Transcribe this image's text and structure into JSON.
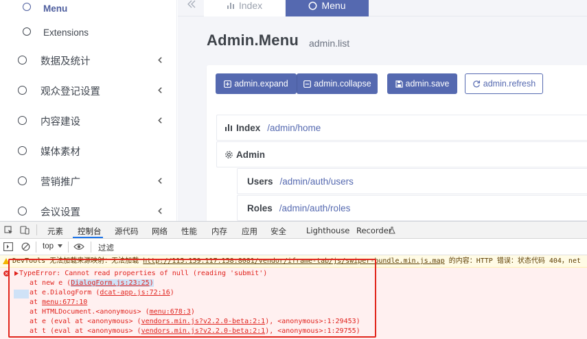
{
  "sidebar": {
    "items": [
      {
        "label": "Menu",
        "level": "sub",
        "active": true,
        "has_children": false
      },
      {
        "label": "Extensions",
        "level": "sub",
        "active": false,
        "has_children": false
      },
      {
        "label": "数据及统计",
        "level": "top",
        "active": false,
        "has_children": true
      },
      {
        "label": "观众登记设置",
        "level": "top",
        "active": false,
        "has_children": true
      },
      {
        "label": "内容建设",
        "level": "top",
        "active": false,
        "has_children": true
      },
      {
        "label": "媒体素材",
        "level": "top",
        "active": false,
        "has_children": false
      },
      {
        "label": "营销推广",
        "level": "top",
        "active": false,
        "has_children": true
      },
      {
        "label": "会议设置",
        "level": "top",
        "active": false,
        "has_children": true
      }
    ]
  },
  "tabs": {
    "index_label": "Index",
    "menu_label": "Menu"
  },
  "header": {
    "title": "Admin.Menu",
    "subtitle": "admin.list"
  },
  "toolbar": {
    "expand_label": "admin.expand",
    "collapse_label": "admin.collapse",
    "save_label": "admin.save",
    "refresh_label": "admin.refresh"
  },
  "tree": [
    {
      "name": "Index",
      "path": "/admin/home",
      "icon": "bar-chart-icon"
    },
    {
      "name": "Admin",
      "path": "",
      "icon": "gear-icon"
    },
    {
      "name": "Users",
      "path": "/admin/auth/users",
      "icon": ""
    },
    {
      "name": "Roles",
      "path": "/admin/auth/roles",
      "icon": ""
    }
  ],
  "devtools": {
    "tabs": [
      "元素",
      "控制台",
      "源代码",
      "网络",
      "性能",
      "内存",
      "应用",
      "安全",
      "Lighthouse",
      "Recorder"
    ],
    "active_tab": "控制台",
    "context": "top",
    "filter_placeholder": "过滤",
    "warning": {
      "prefix": "DevTools 无法加载来源映射：无法加载 ",
      "url": "http://115.159.117.158:8081/vendor/iframe-tab/js/swiper-bundle.min.js.map",
      "suffix": " 的内容：HTTP 错误：状态代码 404，net"
    },
    "error": {
      "message": "TypeError: Cannot read properties of null (reading 'submit')",
      "stack": [
        {
          "pre": "at new e (",
          "link": "DialogForm.js:23:25",
          "post": ")"
        },
        {
          "pre": "at e.DialogForm (",
          "link": "dcat-app.js:72:16",
          "post": ")"
        },
        {
          "pre": "at ",
          "link": "menu:677:10",
          "post": ""
        },
        {
          "pre": "at HTMLDocument.<anonymous> (",
          "link": "menu:678:3",
          "post": ")"
        },
        {
          "pre": "at e (eval at <anonymous> (",
          "link": "vendors.min.js?v2.2.0-beta:2:1",
          "post": "), <anonymous>:1:29453)"
        },
        {
          "pre": "at t (eval at <anonymous> (",
          "link": "vendors.min.js?v2.2.0-beta:2:1",
          "post": "), <anonymous>:1:29755)"
        }
      ]
    }
  },
  "colors": {
    "accent": "#5569b0",
    "error_text": "#e0221d",
    "error_bg": "#fff0f0",
    "highlight_box": "#e1251b"
  }
}
